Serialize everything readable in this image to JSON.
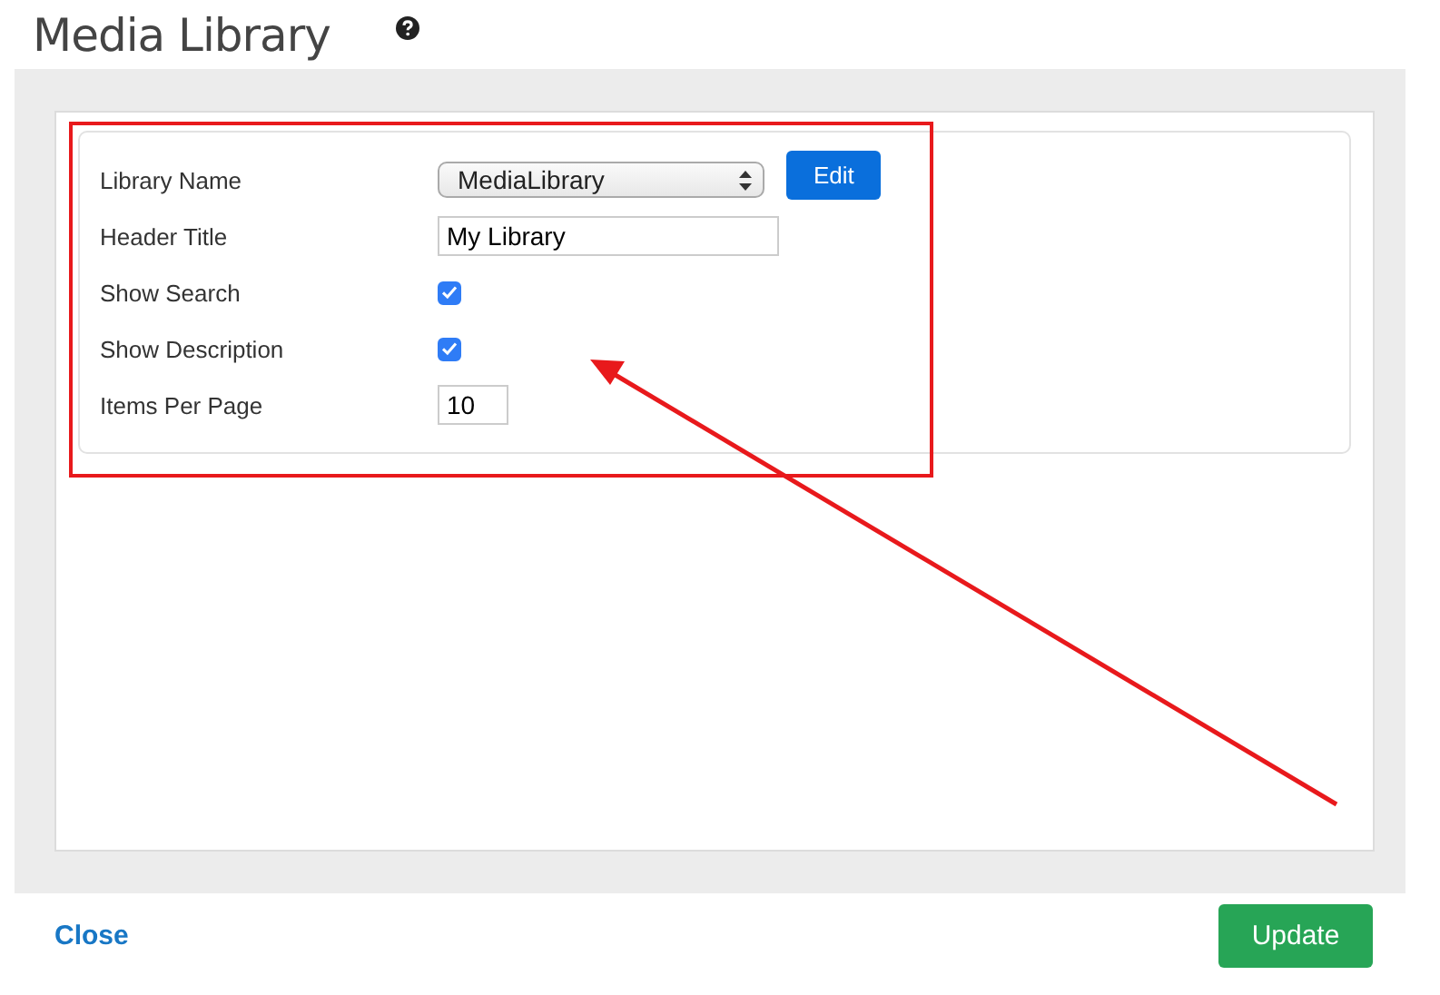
{
  "header": {
    "title": "Media Library"
  },
  "form": {
    "rows": [
      {
        "kind": "select",
        "label": "Library Name",
        "value": "MediaLibrary",
        "button": "Edit"
      },
      {
        "kind": "text",
        "label": "Header Title",
        "value": "My Library"
      },
      {
        "kind": "checkbox",
        "label": "Show Search",
        "checked": true
      },
      {
        "kind": "checkbox",
        "label": "Show Description",
        "checked": true
      },
      {
        "kind": "number",
        "label": "Items Per Page",
        "value": "10"
      }
    ]
  },
  "footer": {
    "close": "Close",
    "update": "Update"
  }
}
